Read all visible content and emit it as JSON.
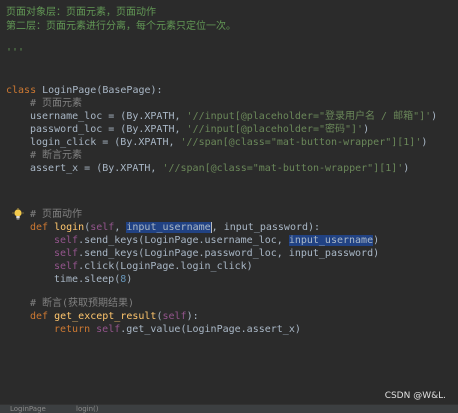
{
  "code": {
    "doc_line_1": "页面对象层：页面元素，页面动作",
    "doc_line_2": "第二层：页面元素进行分离，每个元素只定位一次。",
    "doc_close": "'''",
    "class_kw": "class",
    "class_name": "LoginPage",
    "class_base": "(BasePage):",
    "comment_elements": "# 页面元素",
    "username_loc_lhs": "username_loc = (By.XPATH, ",
    "username_loc_str": "'//input[@placeholder=\"登录用户名 / 邮箱\"]'",
    "username_loc_end": ")",
    "password_loc_lhs": "password_loc = (By.XPATH, ",
    "password_loc_str": "'//input[@placeholder=\"密码\"]'",
    "password_loc_end": ")",
    "login_click_lhs": "login_click = (By.XPATH, ",
    "login_click_str": "'//span[@class=\"mat-button-wrapper\"][1]'",
    "login_click_end": ")",
    "comment_assert_elements": "# 断言元素",
    "assert_x_lhs": "assert_x = (By.XPATH, ",
    "assert_x_str": "'//span[@class=\"mat-button-wrapper\"][1]'",
    "assert_x_end": ")",
    "comment_actions": "# 页面动作",
    "def_kw": "def",
    "login_fn": "login",
    "login_paren_open": "(",
    "login_self": "self",
    "login_sep": ", ",
    "login_param_sel": "input_username",
    "login_params_rest": ", input_password):",
    "body1_self": "self",
    "body1_call": ".send_keys(LoginPage.username_loc, ",
    "body1_arg": "input_username",
    "body1_end": ")",
    "body2_self": "self",
    "body2_call": ".send_keys(LoginPage.password_loc, input_password)",
    "body3_self": "self",
    "body3_call": ".click(LoginPage.login_click)",
    "body4_call": "time.sleep(",
    "body4_num": "8",
    "body4_end": ")",
    "comment_assert": "# 断言(获取预期结果)",
    "get_fn": "get_except_result",
    "get_paren_open": "(",
    "get_self": "self",
    "get_paren_close": "):",
    "return_kw": "return",
    "return_self": "self",
    "return_call": ".get_value(LoginPage.assert_x)"
  },
  "icons": {
    "intention_bulb": "lightbulb-icon"
  },
  "watermark": "CSDN @W&L.",
  "statusbar": {
    "item1": "LoginPage",
    "item2": "login()"
  },
  "colors": {
    "background": "#2b2b2b",
    "keyword": "#cc7832",
    "function": "#ffc66d",
    "self": "#94558d",
    "string": "#6a8759",
    "docstring": "#629755",
    "comment": "#808080",
    "number": "#6897bb",
    "text": "#a9b7c6",
    "selection": "#214283"
  }
}
